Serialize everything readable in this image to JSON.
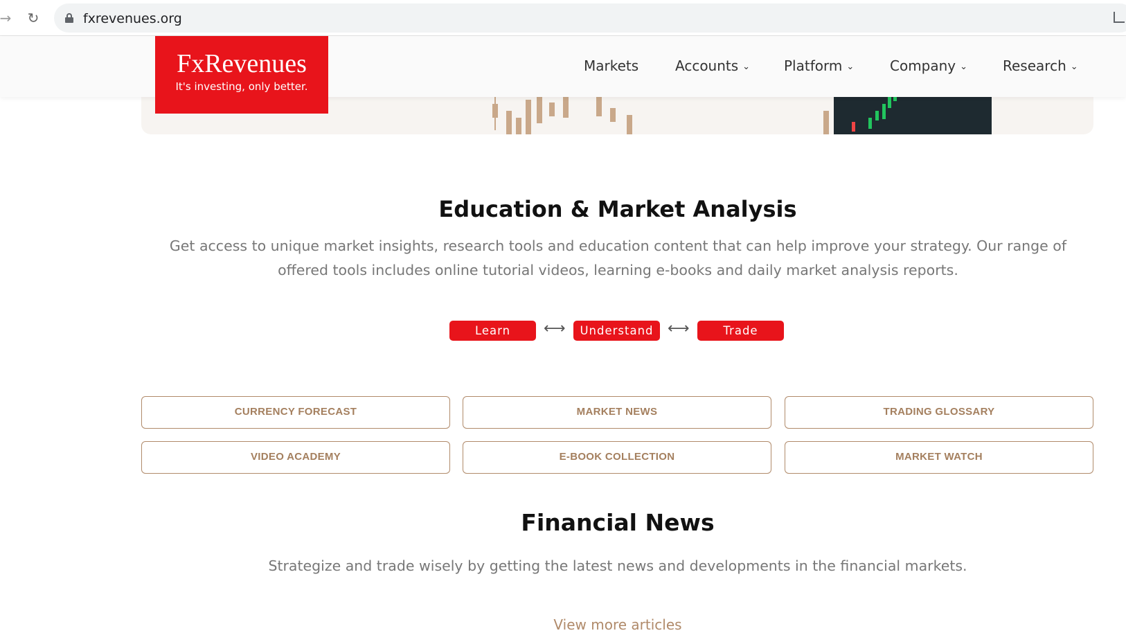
{
  "browser": {
    "url": "fxrevenues.org"
  },
  "header": {
    "logo_brand": "FxRevenues",
    "logo_tagline": "It's investing, only better.",
    "nav": [
      {
        "label": "Markets",
        "has_dropdown": false
      },
      {
        "label": "Accounts",
        "has_dropdown": true
      },
      {
        "label": "Platform",
        "has_dropdown": true
      },
      {
        "label": "Company",
        "has_dropdown": true
      },
      {
        "label": "Research",
        "has_dropdown": true
      }
    ]
  },
  "education": {
    "title": "Education & Market Analysis",
    "description": "Get access to unique market insights, research tools and education content that can help improve your strategy. Our range of offered tools includes online tutorial videos, learning e-books and daily market analysis reports.",
    "steps": [
      "Learn",
      "Understand",
      "Trade"
    ],
    "tools": [
      "CURRENCY FORECAST",
      "MARKET NEWS",
      "TRADING GLOSSARY",
      "VIDEO ACADEMY",
      "E-BOOK COLLECTION",
      "MARKET WATCH"
    ]
  },
  "news": {
    "title": "Financial News",
    "description": "Strategize and trade wisely by getting the latest news and developments in the financial markets.",
    "more_link": "View more articles"
  },
  "colors": {
    "brand_red": "#e8141b",
    "accent_bronze": "#b08a6a"
  },
  "icons": {
    "back": "arrow-right-icon",
    "reload": "reload-icon",
    "lock": "lock-icon",
    "swap": "double-arrow-icon",
    "dropdown": "chevron-down-icon"
  }
}
